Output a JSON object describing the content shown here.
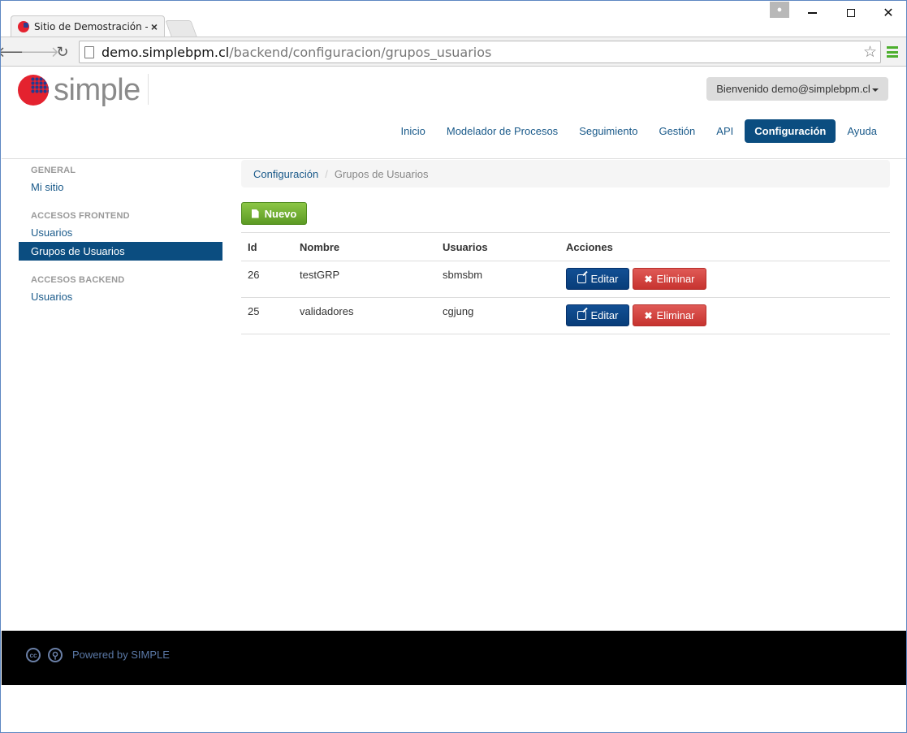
{
  "browser": {
    "tab_title": "Sitio de Demostración - C",
    "tab_close": "×",
    "url_host": "demo.simplebpm.cl",
    "url_path": "/backend/configuracion/grupos_usuarios"
  },
  "header": {
    "logo_text": "simple",
    "user_menu": "Bienvenido demo@simplebpm.cl",
    "nav": [
      {
        "label": "Inicio"
      },
      {
        "label": "Modelador de Procesos"
      },
      {
        "label": "Seguimiento"
      },
      {
        "label": "Gestión"
      },
      {
        "label": "API"
      },
      {
        "label": "Configuración"
      },
      {
        "label": "Ayuda"
      }
    ]
  },
  "sidebar": {
    "general_header": "GENERAL",
    "general_items": [
      "Mi sitio"
    ],
    "frontend_header": "ACCESOS FRONTEND",
    "frontend_items": [
      "Usuarios",
      "Grupos de Usuarios"
    ],
    "backend_header": "ACCESOS BACKEND",
    "backend_items": [
      "Usuarios"
    ]
  },
  "breadcrumb": {
    "parent": "Configuración",
    "separator": "/",
    "current": "Grupos de Usuarios"
  },
  "toolbar": {
    "new_label": "Nuevo"
  },
  "table": {
    "headers": [
      "Id",
      "Nombre",
      "Usuarios",
      "Acciones"
    ],
    "rows": [
      {
        "id": "26",
        "name": "testGRP",
        "users": "sbmsbm"
      },
      {
        "id": "25",
        "name": "validadores",
        "users": "cgjung"
      }
    ],
    "edit_label": "Editar",
    "delete_label": "Eliminar"
  },
  "footer": {
    "cc_label": "cc",
    "powered": "Powered by SIMPLE"
  },
  "colors": {
    "primary": "#0b4d80",
    "success": "#6aac2e",
    "danger": "#d9534f",
    "link": "#1a5a8a"
  }
}
